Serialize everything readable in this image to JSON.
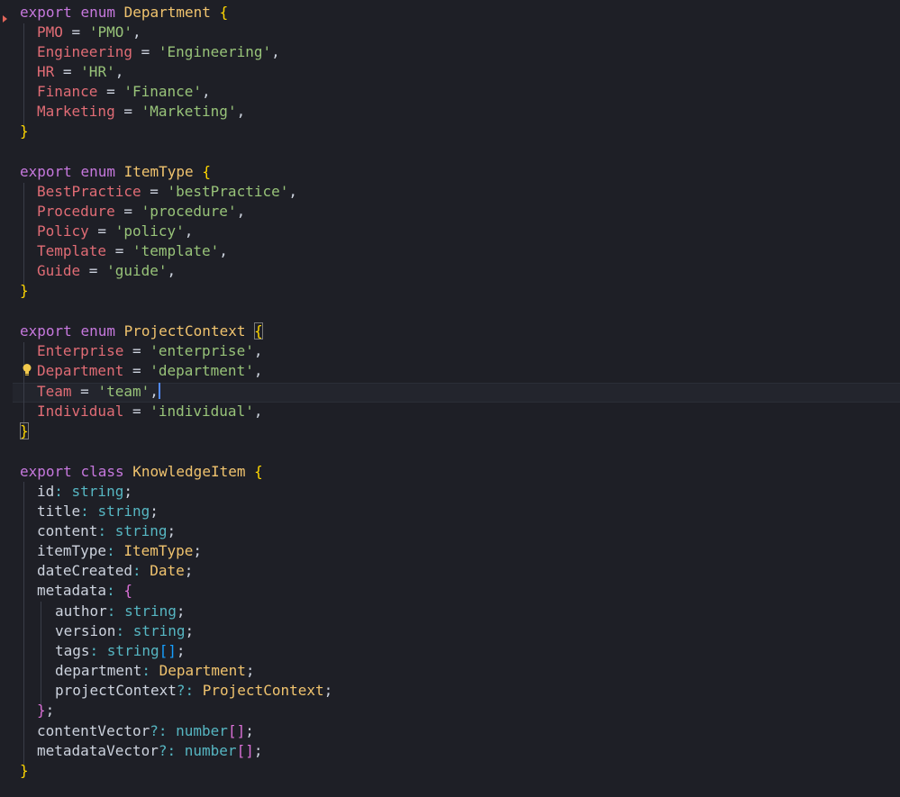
{
  "editor": {
    "language": "typescript",
    "cursor_line": "Team = 'team',",
    "colors": {
      "background": "#1e1f26",
      "keyword": "#c678dd",
      "type": "#f0c36e",
      "member": "#e06c75",
      "string": "#98c379",
      "primitive": "#56b6c2",
      "bracket1": "#ffd700",
      "bracket2": "#da70d6",
      "bracket3": "#179fff"
    },
    "icons": [
      "fold-marker-icon",
      "lightbulb-icon"
    ]
  },
  "code": {
    "kw_export": "export",
    "kw_enum": "enum",
    "kw_class": "class",
    "department_enum": {
      "name": "Department",
      "members": [
        {
          "name": "PMO",
          "value": "'PMO'"
        },
        {
          "name": "Engineering",
          "value": "'Engineering'"
        },
        {
          "name": "HR",
          "value": "'HR'"
        },
        {
          "name": "Finance",
          "value": "'Finance'"
        },
        {
          "name": "Marketing",
          "value": "'Marketing'"
        }
      ]
    },
    "itemtype_enum": {
      "name": "ItemType",
      "members": [
        {
          "name": "BestPractice",
          "value": "'bestPractice'"
        },
        {
          "name": "Procedure",
          "value": "'procedure'"
        },
        {
          "name": "Policy",
          "value": "'policy'"
        },
        {
          "name": "Template",
          "value": "'template'"
        },
        {
          "name": "Guide",
          "value": "'guide'"
        }
      ]
    },
    "projectcontext_enum": {
      "name": "ProjectContext",
      "members": [
        {
          "name": "Enterprise",
          "value": "'enterprise'"
        },
        {
          "name": "Department",
          "value": "'department'"
        },
        {
          "name": "Team",
          "value": "'team'"
        },
        {
          "name": "Individual",
          "value": "'individual'"
        }
      ]
    },
    "knowledge_class": {
      "name": "KnowledgeItem",
      "fields": [
        {
          "name": "id",
          "type": "string"
        },
        {
          "name": "title",
          "type": "string"
        },
        {
          "name": "content",
          "type": "string"
        },
        {
          "name": "itemType",
          "type": "ItemType"
        },
        {
          "name": "dateCreated",
          "type": "Date"
        },
        {
          "name": "metadata"
        }
      ],
      "metadata_fields": [
        {
          "name": "author",
          "type": "string"
        },
        {
          "name": "version",
          "type": "string"
        },
        {
          "name": "tags",
          "type": "string"
        },
        {
          "name": "department",
          "type": "Department"
        },
        {
          "name": "projectContext",
          "type": "ProjectContext"
        }
      ],
      "tail_fields": [
        {
          "name": "contentVector",
          "type": "number"
        },
        {
          "name": "metadataVector",
          "type": "number"
        }
      ]
    },
    "punct": {
      "eq": " = ",
      "comma": ",",
      "semi": ";",
      "colon": ": ",
      "optcolon": "?: ",
      "lbrace": "{",
      "rbrace": "}",
      "arr": "[]"
    }
  }
}
